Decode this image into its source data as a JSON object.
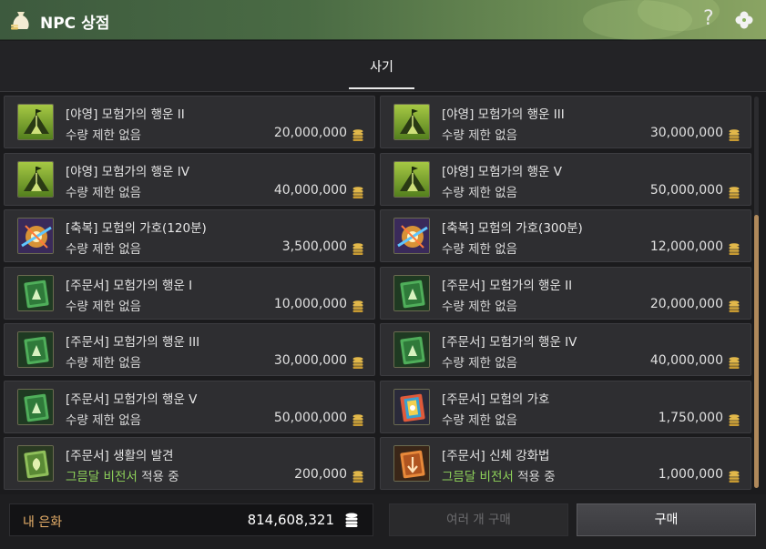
{
  "window": {
    "title": "NPC 상점"
  },
  "tabs": [
    {
      "label": "사기"
    }
  ],
  "items": [
    {
      "name": "[야영] 모험가의 행운 II",
      "qty_text": "수량 제한 없음",
      "qty_highlight": "",
      "price": "20,000,000",
      "icon": "camp-tent-icon"
    },
    {
      "name": "[야영] 모험가의 행운 III",
      "qty_text": "수량 제한 없음",
      "qty_highlight": "",
      "price": "30,000,000",
      "icon": "camp-tent-icon"
    },
    {
      "name": "[야영] 모험가의 행운 IV",
      "qty_text": "수량 제한 없음",
      "qty_highlight": "",
      "price": "40,000,000",
      "icon": "camp-tent-icon"
    },
    {
      "name": "[야영] 모험가의 행운 V",
      "qty_text": "수량 제한 없음",
      "qty_highlight": "",
      "price": "50,000,000",
      "icon": "camp-tent-icon"
    },
    {
      "name": "[축복] 모험의 가호(120분)",
      "qty_text": "수량 제한 없음",
      "qty_highlight": "",
      "price": "3,500,000",
      "icon": "blessing-burst-icon"
    },
    {
      "name": "[축복] 모험의 가호(300분)",
      "qty_text": "수량 제한 없음",
      "qty_highlight": "",
      "price": "12,000,000",
      "icon": "blessing-burst-icon"
    },
    {
      "name": "[주문서] 모험가의 행운 I",
      "qty_text": "수량 제한 없음",
      "qty_highlight": "",
      "price": "10,000,000",
      "icon": "green-scroll-icon"
    },
    {
      "name": "[주문서] 모험가의 행운 II",
      "qty_text": "수량 제한 없음",
      "qty_highlight": "",
      "price": "20,000,000",
      "icon": "green-scroll-icon"
    },
    {
      "name": "[주문서] 모험가의 행운 III",
      "qty_text": "수량 제한 없음",
      "qty_highlight": "",
      "price": "30,000,000",
      "icon": "green-scroll-icon"
    },
    {
      "name": "[주문서] 모험가의 행운 IV",
      "qty_text": "수량 제한 없음",
      "qty_highlight": "",
      "price": "40,000,000",
      "icon": "green-scroll-icon"
    },
    {
      "name": "[주문서] 모험가의 행운 V",
      "qty_text": "수량 제한 없음",
      "qty_highlight": "",
      "price": "50,000,000",
      "icon": "green-scroll-icon"
    },
    {
      "name": "[주문서] 모험의 가호",
      "qty_text": "수량 제한 없음",
      "qty_highlight": "",
      "price": "1,750,000",
      "icon": "rainbow-scroll-icon"
    },
    {
      "name": "[주문서] 생활의 발견",
      "qty_text": " 적용 중",
      "qty_highlight": "그믐달 비전서",
      "price": "200,000",
      "icon": "life-scroll-icon"
    },
    {
      "name": "[주문서] 신체 강화법",
      "qty_text": " 적용 중",
      "qty_highlight": "그믐달 비전서",
      "price": "1,000,000",
      "icon": "orange-scroll-icon"
    }
  ],
  "wallet": {
    "label": "내 은화",
    "value": "814,608,321"
  },
  "buttons": {
    "multi_label": "여러 개 구매",
    "buy_label": "구매"
  },
  "colors": {
    "qty_highlight": "#8fd35a",
    "wallet_label": "#e8b06a",
    "scroll_thumb": "#b0895b",
    "titlebar": "#4a6b44"
  }
}
